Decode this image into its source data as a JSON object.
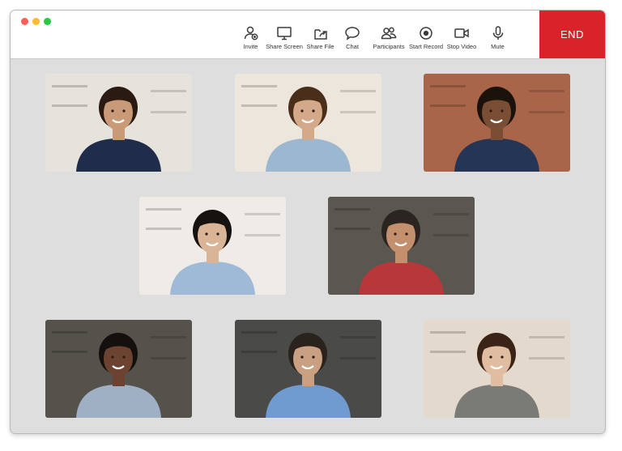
{
  "window": {
    "traffic_lights": [
      {
        "name": "close",
        "color": "#ff5f57"
      },
      {
        "name": "minimize",
        "color": "#febc2e"
      },
      {
        "name": "maximize",
        "color": "#28c840"
      }
    ]
  },
  "toolbar": {
    "tools": [
      {
        "id": "invite",
        "label": "Invite",
        "icon": "add-user-icon"
      },
      {
        "id": "share-screen",
        "label": "Share Screen",
        "icon": "monitor-icon"
      },
      {
        "id": "share-file",
        "label": "Share File",
        "icon": "share-file-icon"
      },
      {
        "id": "chat",
        "label": "Chat",
        "icon": "chat-bubble-icon"
      },
      {
        "id": "participants",
        "label": "Participants",
        "icon": "participants-icon"
      },
      {
        "id": "start-record",
        "label": "Start Record",
        "icon": "record-icon"
      },
      {
        "id": "stop-video",
        "label": "Stop Video",
        "icon": "video-camera-icon"
      },
      {
        "id": "mute",
        "label": "Mute",
        "icon": "microphone-icon"
      }
    ],
    "end_label": "END",
    "end_color": "#d9222a"
  },
  "participants": [
    {
      "id": 1,
      "shirt": "#1f2c4a",
      "hair": "#2a1a12",
      "skin": "#c99a78",
      "bg": "#e6e2dc"
    },
    {
      "id": 2,
      "shirt": "#9cb8d0",
      "hair": "#4a2e1a",
      "skin": "#d3a98a",
      "bg": "#ece6dc"
    },
    {
      "id": 3,
      "shirt": "#243556",
      "hair": "#1b120c",
      "skin": "#7a4e34",
      "bg": "#a8654a"
    },
    {
      "id": 4,
      "shirt": "#9fbad6",
      "hair": "#161210",
      "skin": "#d9b497",
      "bg": "#efece7"
    },
    {
      "id": 5,
      "shirt": "#b8373a",
      "hair": "#2b2420",
      "skin": "#c38f6d",
      "bg": "#5a5650"
    },
    {
      "id": 6,
      "shirt": "#9fb0c4",
      "hair": "#14100e",
      "skin": "#6b4330",
      "bg": "#55524c"
    },
    {
      "id": 7,
      "shirt": "#6f9bd0",
      "hair": "#2a221c",
      "skin": "#c9a081",
      "bg": "#4a4a48"
    },
    {
      "id": 8,
      "shirt": "#7a7a76",
      "hair": "#3a2418",
      "skin": "#e0bca0",
      "bg": "#e3d9cc"
    }
  ]
}
